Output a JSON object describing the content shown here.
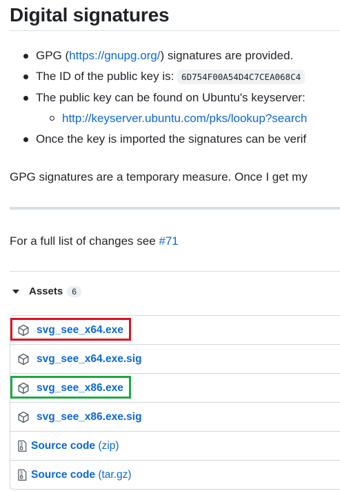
{
  "heading": "Digital signatures",
  "bullets": {
    "gpg_prefix": "GPG (",
    "gpg_link": "https://gnupg.org/",
    "gpg_suffix": ") signatures are provided.",
    "id_prefix": "The ID of the public key is: ",
    "id_code": "6D754F00A54D4C7CEA068C4",
    "keyserver_text": "The public key can be found on Ubuntu's keyserver:",
    "keyserver_link": "http://keyserver.ubuntu.com/pks/lookup?search",
    "import_text": "Once the key is imported the signatures can be verif"
  },
  "note": "GPG signatures are a temporary measure. Once I get my",
  "changes": {
    "prefix": "For a full list of changes see ",
    "link": "#71"
  },
  "assets": {
    "label": "Assets",
    "count": "6",
    "items": [
      {
        "name": "svg_see_x64.exe",
        "highlight_color": "#e3101e"
      },
      {
        "name": "svg_see_x64.exe.sig"
      },
      {
        "name": "svg_see_x86.exe",
        "highlight_color": "#1aab3f"
      },
      {
        "name": "svg_see_x86.exe.sig"
      },
      {
        "name": "Source code",
        "format": "(zip)"
      },
      {
        "name": "Source code",
        "format": "(tar.gz)"
      }
    ]
  }
}
